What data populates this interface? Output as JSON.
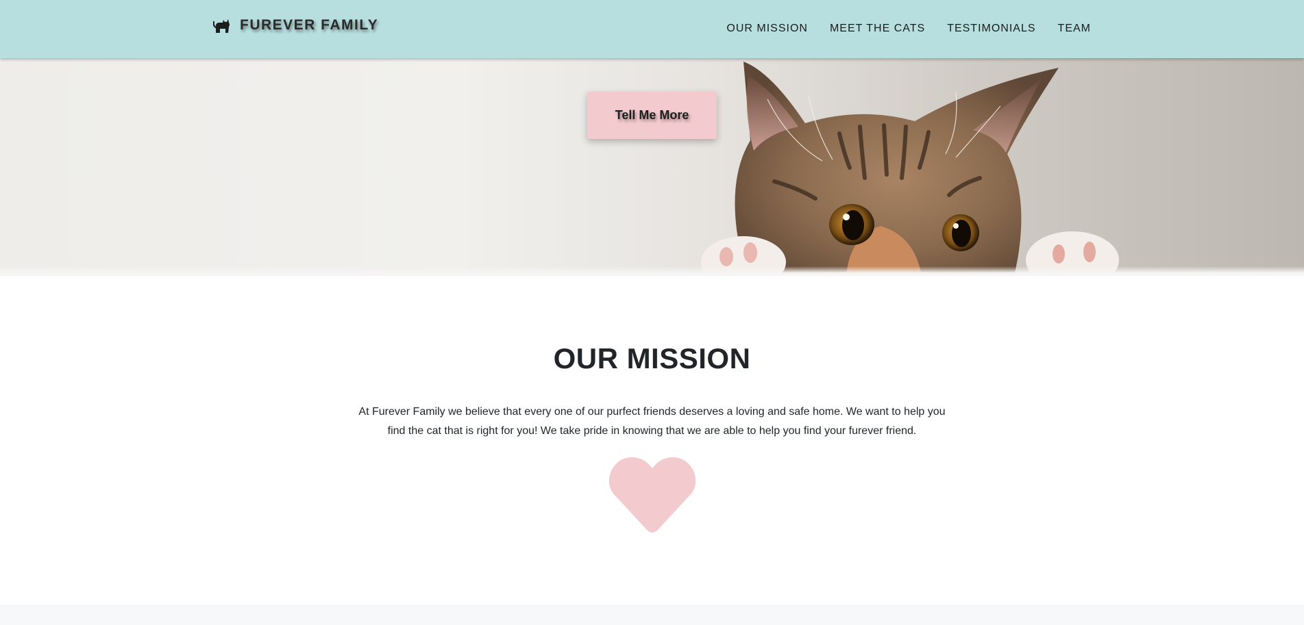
{
  "brand": {
    "name": "FUREVER FAMILY",
    "icon": "cat-icon"
  },
  "nav": {
    "links": [
      {
        "label": "OUR MISSION"
      },
      {
        "label": "MEET THE CATS"
      },
      {
        "label": "TESTIMONIALS"
      },
      {
        "label": "TEAM"
      }
    ]
  },
  "hero": {
    "button_label": "Tell Me More",
    "image": "peeking-tabby-cat"
  },
  "mission": {
    "title": "OUR MISSION",
    "text": "At Furever Family we believe that every one of our purfect friends deserves a loving and safe home. We want to help you find the cat that is right for you! We take pride in knowing that we are able to help you find your furever friend.",
    "icon": "heart-icon"
  },
  "colors": {
    "navbar": "#b8dfe0",
    "accent_pink": "#f3cace",
    "text": "#212529"
  }
}
